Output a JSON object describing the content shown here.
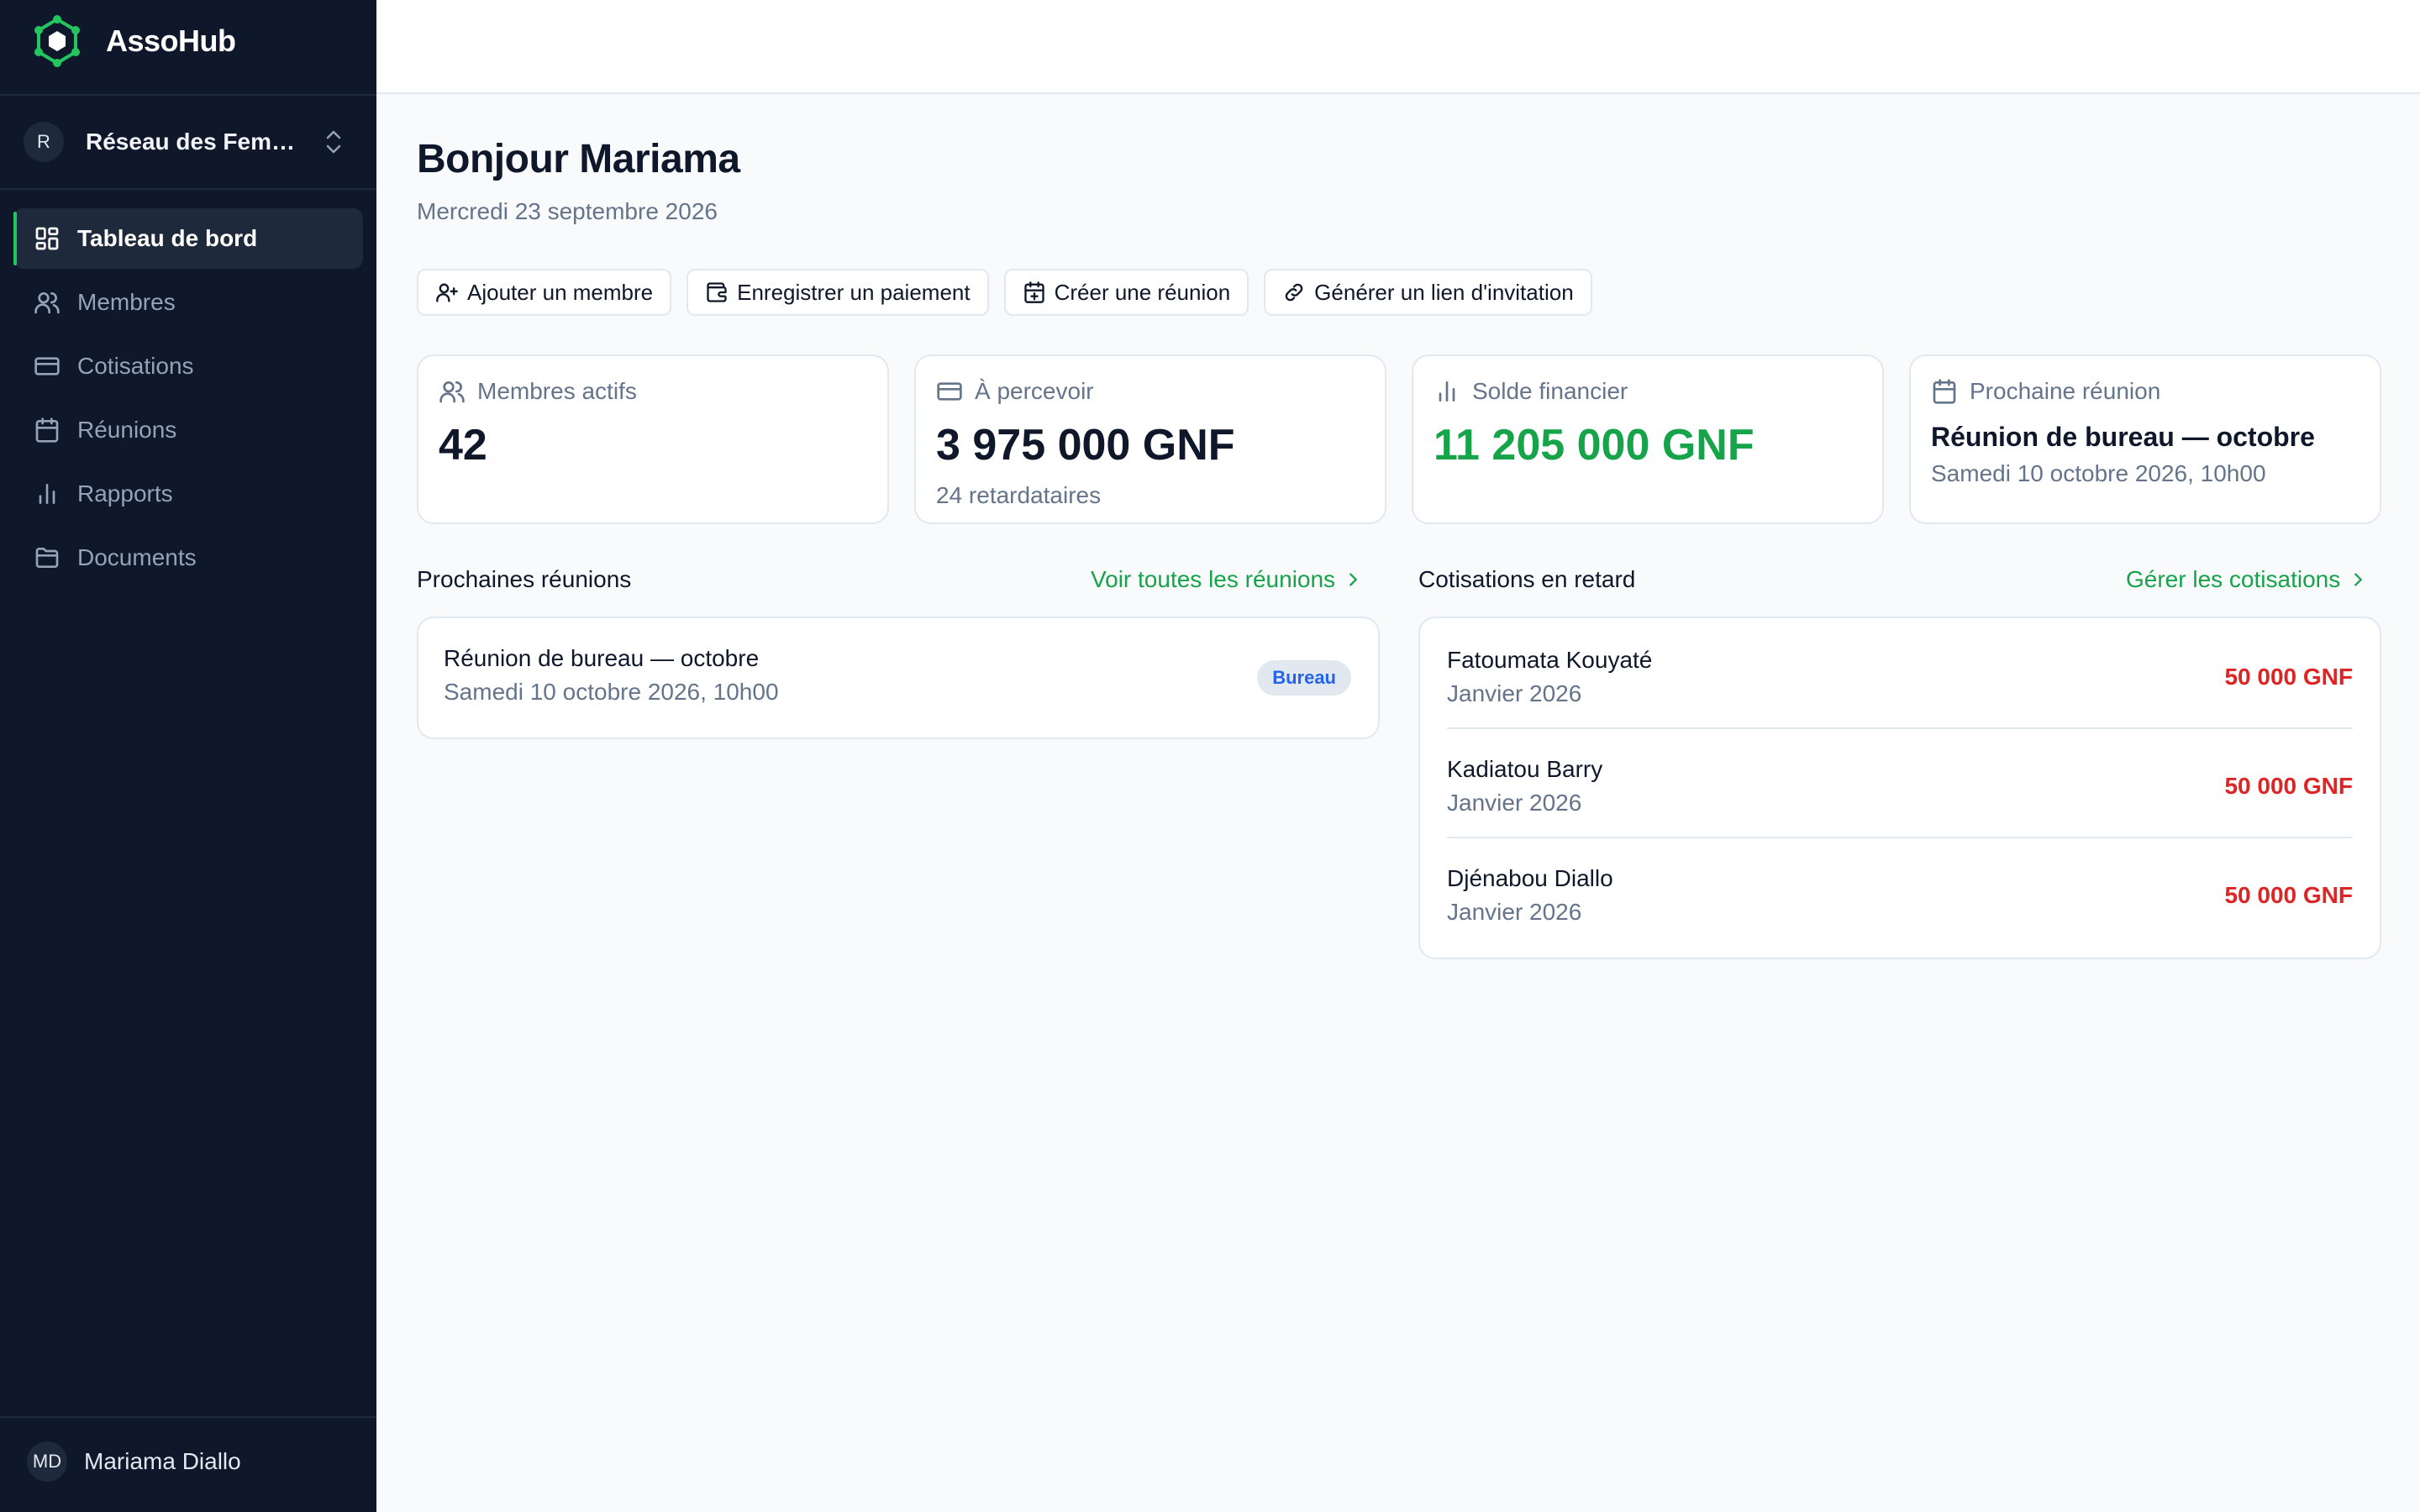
{
  "app": {
    "name": "AssoHub",
    "brand_color": "#22c55e"
  },
  "org": {
    "initial": "R",
    "name": "Réseau des Femm..."
  },
  "nav": [
    {
      "label": "Tableau de bord",
      "icon": "dashboard-icon",
      "active": true
    },
    {
      "label": "Membres",
      "icon": "users-icon"
    },
    {
      "label": "Cotisations",
      "icon": "credit-card-icon"
    },
    {
      "label": "Réunions",
      "icon": "calendar-icon"
    },
    {
      "label": "Rapports",
      "icon": "bar-chart-icon"
    },
    {
      "label": "Documents",
      "icon": "folder-icon"
    }
  ],
  "user": {
    "initials": "MD",
    "name": "Mariama Diallo"
  },
  "page": {
    "greeting": "Bonjour Mariama",
    "date": "Mercredi 23 septembre 2026"
  },
  "actions": [
    {
      "label": "Ajouter un membre",
      "icon": "user-plus-icon"
    },
    {
      "label": "Enregistrer un paiement",
      "icon": "wallet-icon"
    },
    {
      "label": "Créer une réunion",
      "icon": "calendar-plus-icon"
    },
    {
      "label": "Générer un lien d'invitation",
      "icon": "link-icon"
    }
  ],
  "stats": {
    "members": {
      "label": "Membres actifs",
      "value": "42"
    },
    "receivable": {
      "label": "À percevoir",
      "value": "3 975 000 GNF",
      "sub": "24 retardataires"
    },
    "balance": {
      "label": "Solde financier",
      "value": "11 205 000 GNF",
      "color": "#16a34a"
    },
    "next_meeting": {
      "label": "Prochaine réunion",
      "title": "Réunion de bureau — octobre",
      "sub": "Samedi 10 octobre 2026, 10h00"
    }
  },
  "meetings": {
    "title": "Prochaines réunions",
    "link": "Voir toutes les réunions",
    "items": [
      {
        "title": "Réunion de bureau — octobre",
        "date": "Samedi 10 octobre 2026, 10h00",
        "badge": "Bureau"
      }
    ]
  },
  "late": {
    "title": "Cotisations en retard",
    "link": "Gérer les cotisations",
    "items": [
      {
        "name": "Fatoumata Kouyaté",
        "period": "Janvier 2026",
        "amount": "50 000 GNF"
      },
      {
        "name": "Kadiatou Barry",
        "period": "Janvier 2026",
        "amount": "50 000 GNF"
      },
      {
        "name": "Djénabou Diallo",
        "period": "Janvier 2026",
        "amount": "50 000 GNF"
      }
    ],
    "amount_color": "#dc2626"
  }
}
